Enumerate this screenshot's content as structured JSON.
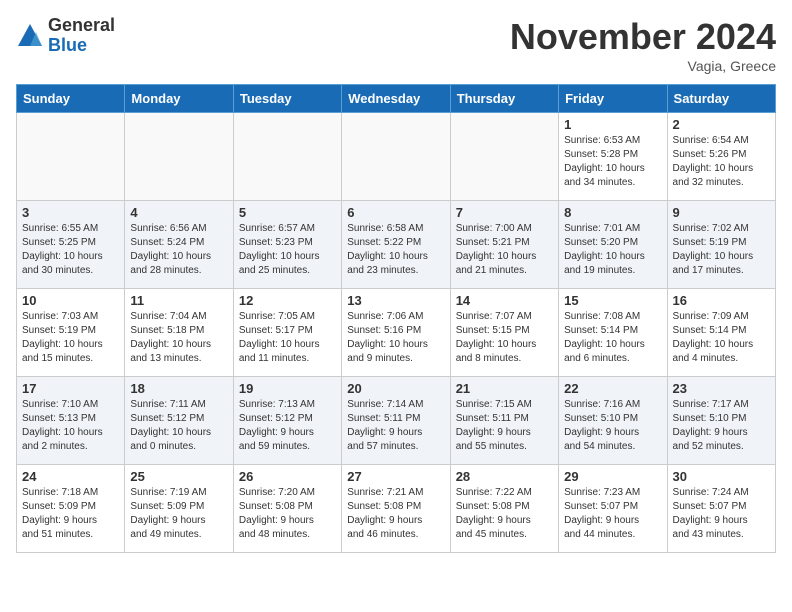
{
  "header": {
    "logo_line1": "General",
    "logo_line2": "Blue",
    "month_title": "November 2024",
    "location": "Vagia, Greece"
  },
  "weekdays": [
    "Sunday",
    "Monday",
    "Tuesday",
    "Wednesday",
    "Thursday",
    "Friday",
    "Saturday"
  ],
  "weeks": [
    [
      {
        "day": "",
        "info": ""
      },
      {
        "day": "",
        "info": ""
      },
      {
        "day": "",
        "info": ""
      },
      {
        "day": "",
        "info": ""
      },
      {
        "day": "",
        "info": ""
      },
      {
        "day": "1",
        "info": "Sunrise: 6:53 AM\nSunset: 5:28 PM\nDaylight: 10 hours\nand 34 minutes."
      },
      {
        "day": "2",
        "info": "Sunrise: 6:54 AM\nSunset: 5:26 PM\nDaylight: 10 hours\nand 32 minutes."
      }
    ],
    [
      {
        "day": "3",
        "info": "Sunrise: 6:55 AM\nSunset: 5:25 PM\nDaylight: 10 hours\nand 30 minutes."
      },
      {
        "day": "4",
        "info": "Sunrise: 6:56 AM\nSunset: 5:24 PM\nDaylight: 10 hours\nand 28 minutes."
      },
      {
        "day": "5",
        "info": "Sunrise: 6:57 AM\nSunset: 5:23 PM\nDaylight: 10 hours\nand 25 minutes."
      },
      {
        "day": "6",
        "info": "Sunrise: 6:58 AM\nSunset: 5:22 PM\nDaylight: 10 hours\nand 23 minutes."
      },
      {
        "day": "7",
        "info": "Sunrise: 7:00 AM\nSunset: 5:21 PM\nDaylight: 10 hours\nand 21 minutes."
      },
      {
        "day": "8",
        "info": "Sunrise: 7:01 AM\nSunset: 5:20 PM\nDaylight: 10 hours\nand 19 minutes."
      },
      {
        "day": "9",
        "info": "Sunrise: 7:02 AM\nSunset: 5:19 PM\nDaylight: 10 hours\nand 17 minutes."
      }
    ],
    [
      {
        "day": "10",
        "info": "Sunrise: 7:03 AM\nSunset: 5:19 PM\nDaylight: 10 hours\nand 15 minutes."
      },
      {
        "day": "11",
        "info": "Sunrise: 7:04 AM\nSunset: 5:18 PM\nDaylight: 10 hours\nand 13 minutes."
      },
      {
        "day": "12",
        "info": "Sunrise: 7:05 AM\nSunset: 5:17 PM\nDaylight: 10 hours\nand 11 minutes."
      },
      {
        "day": "13",
        "info": "Sunrise: 7:06 AM\nSunset: 5:16 PM\nDaylight: 10 hours\nand 9 minutes."
      },
      {
        "day": "14",
        "info": "Sunrise: 7:07 AM\nSunset: 5:15 PM\nDaylight: 10 hours\nand 8 minutes."
      },
      {
        "day": "15",
        "info": "Sunrise: 7:08 AM\nSunset: 5:14 PM\nDaylight: 10 hours\nand 6 minutes."
      },
      {
        "day": "16",
        "info": "Sunrise: 7:09 AM\nSunset: 5:14 PM\nDaylight: 10 hours\nand 4 minutes."
      }
    ],
    [
      {
        "day": "17",
        "info": "Sunrise: 7:10 AM\nSunset: 5:13 PM\nDaylight: 10 hours\nand 2 minutes."
      },
      {
        "day": "18",
        "info": "Sunrise: 7:11 AM\nSunset: 5:12 PM\nDaylight: 10 hours\nand 0 minutes."
      },
      {
        "day": "19",
        "info": "Sunrise: 7:13 AM\nSunset: 5:12 PM\nDaylight: 9 hours\nand 59 minutes."
      },
      {
        "day": "20",
        "info": "Sunrise: 7:14 AM\nSunset: 5:11 PM\nDaylight: 9 hours\nand 57 minutes."
      },
      {
        "day": "21",
        "info": "Sunrise: 7:15 AM\nSunset: 5:11 PM\nDaylight: 9 hours\nand 55 minutes."
      },
      {
        "day": "22",
        "info": "Sunrise: 7:16 AM\nSunset: 5:10 PM\nDaylight: 9 hours\nand 54 minutes."
      },
      {
        "day": "23",
        "info": "Sunrise: 7:17 AM\nSunset: 5:10 PM\nDaylight: 9 hours\nand 52 minutes."
      }
    ],
    [
      {
        "day": "24",
        "info": "Sunrise: 7:18 AM\nSunset: 5:09 PM\nDaylight: 9 hours\nand 51 minutes."
      },
      {
        "day": "25",
        "info": "Sunrise: 7:19 AM\nSunset: 5:09 PM\nDaylight: 9 hours\nand 49 minutes."
      },
      {
        "day": "26",
        "info": "Sunrise: 7:20 AM\nSunset: 5:08 PM\nDaylight: 9 hours\nand 48 minutes."
      },
      {
        "day": "27",
        "info": "Sunrise: 7:21 AM\nSunset: 5:08 PM\nDaylight: 9 hours\nand 46 minutes."
      },
      {
        "day": "28",
        "info": "Sunrise: 7:22 AM\nSunset: 5:08 PM\nDaylight: 9 hours\nand 45 minutes."
      },
      {
        "day": "29",
        "info": "Sunrise: 7:23 AM\nSunset: 5:07 PM\nDaylight: 9 hours\nand 44 minutes."
      },
      {
        "day": "30",
        "info": "Sunrise: 7:24 AM\nSunset: 5:07 PM\nDaylight: 9 hours\nand 43 minutes."
      }
    ]
  ]
}
